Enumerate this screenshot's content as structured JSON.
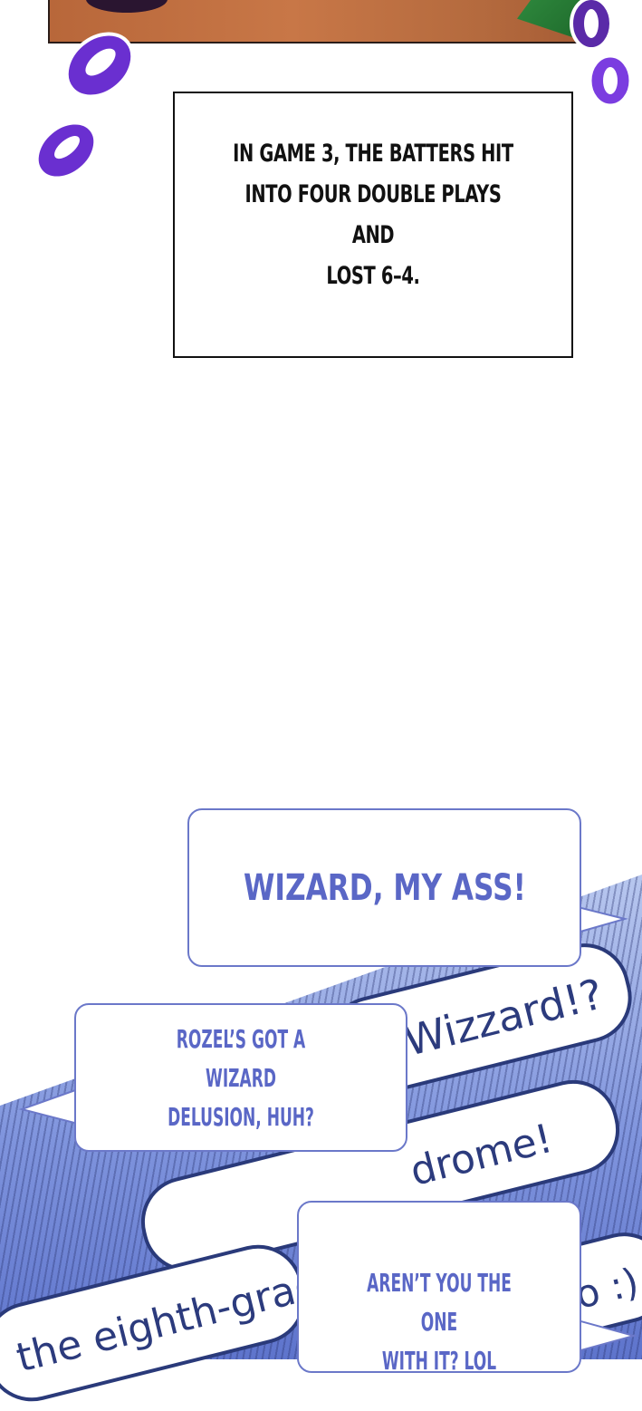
{
  "caption": {
    "line1": "IN GAME 3, THE BATTERS HIT",
    "line2": "INTO FOUR DOUBLE PLAYS AND",
    "line3": "LOST 6–4."
  },
  "chat_background": {
    "pill1": "Wizzard!?",
    "pill2": "drome!",
    "pill3": "the eighth-grad",
    "pill4": "o :)"
  },
  "bubbles": {
    "b1": "WIZARD, MY ASS!",
    "b2_line1": "ROZEL’S GOT A WIZARD",
    "b2_line2": "DELUSION, HUH?",
    "b3_line1": "AREN’T YOU THE ONE",
    "b3_line2": "WITH IT? LOL"
  },
  "colors": {
    "bubble_text": "#5a67c6",
    "bubble_border": "#6b78c9",
    "ring_purple": "#6a2fd0"
  }
}
